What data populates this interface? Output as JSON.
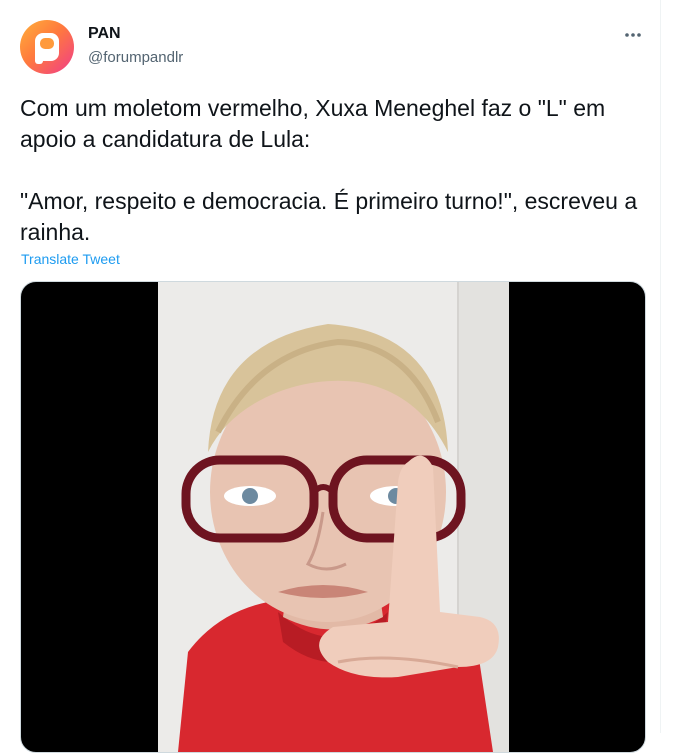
{
  "tweet": {
    "author_name": "PAN",
    "author_handle": "@forumpandlr",
    "avatar_icon": "pan-logo-icon",
    "more_icon": "more-options-icon",
    "text": "Com um moletom vermelho, Xuxa Meneghel faz o \"L\" em apoio a candidatura de Lula:\n\n\"Amor, respeito e democracia. É primeiro turno!\", escreveu a rainha.",
    "translate_label": "Translate Tweet"
  },
  "colors": {
    "link": "#1d9bf0",
    "secondary_text": "#536471",
    "avatar_gradient": [
      "#ffb03a",
      "#f03c8a"
    ]
  }
}
